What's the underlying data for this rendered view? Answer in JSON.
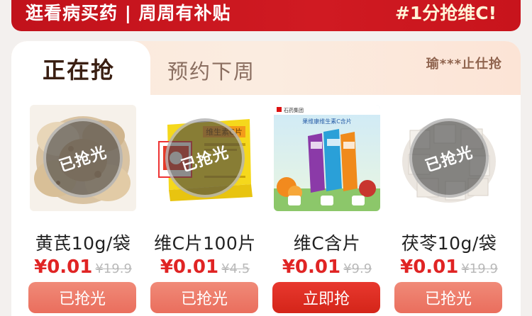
{
  "banner": {
    "slogan": "逛看病买药 | 周周有补贴",
    "promo": "#1分抢维C!"
  },
  "tabs": {
    "active": "正在抢",
    "next": "预约下周",
    "right_partial": "瑜***止仕抢"
  },
  "products": [
    {
      "name": "黄芪10g/袋",
      "price": "¥0.01",
      "original_price": "¥19.9",
      "overlay": "已抢光",
      "button": "已抢光",
      "sold_out": true
    },
    {
      "name": "维C片100片",
      "price": "¥0.01",
      "original_price": "¥4.5",
      "overlay": "已抢光",
      "button": "已抢光",
      "sold_out": true,
      "box_text": "维生素C片"
    },
    {
      "name": "维C含片",
      "price": "¥0.01",
      "original_price": "¥9.9",
      "button": "立即抢",
      "sold_out": false,
      "brand": "石药集团",
      "headline": "果维康维生素C含片"
    },
    {
      "name": "茯苓10g/袋",
      "price": "¥0.01",
      "original_price": "¥19.9",
      "overlay": "已抢光",
      "button": "已抢光",
      "sold_out": true
    }
  ],
  "colors": {
    "banner_red": "#c1121b",
    "price_red": "#e02424",
    "button_disabled": "#ea6e5d",
    "button_active": "#d42519"
  }
}
